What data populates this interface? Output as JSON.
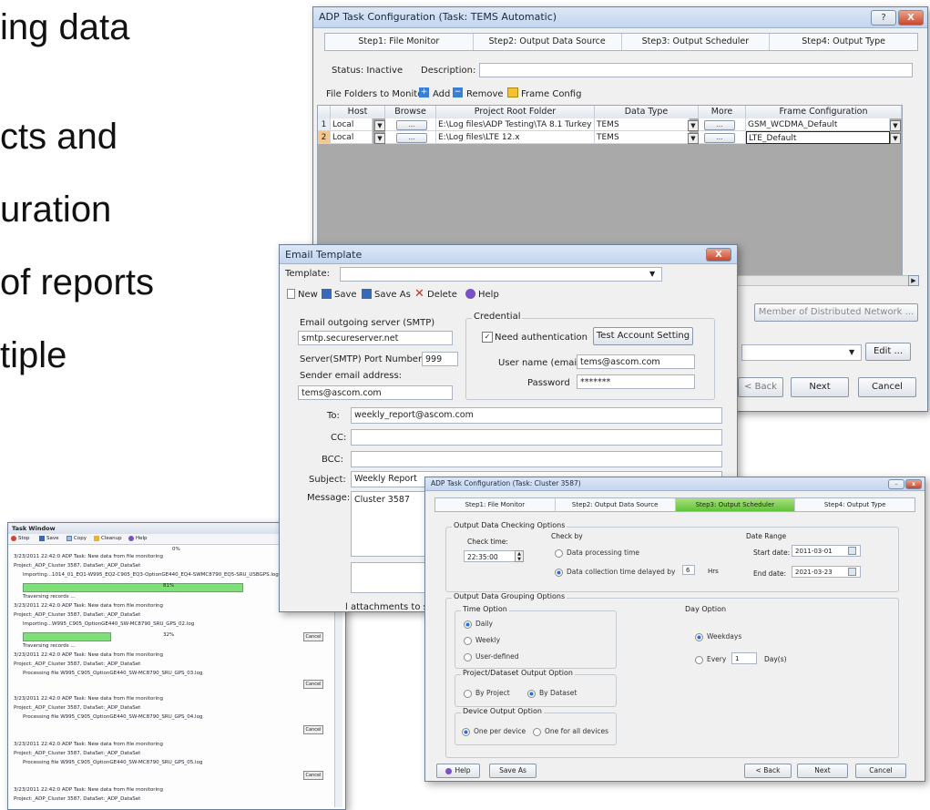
{
  "slide": {
    "bullets": [
      "ing data",
      "cts and",
      "uration",
      "of reports",
      "tiple"
    ]
  },
  "adp_main": {
    "title": "ADP Task Configuration    (Task: TEMS Automatic)",
    "help_btn": "?",
    "close_btn": "X",
    "steps": [
      "Step1: File Monitor",
      "Step2: Output Data Source",
      "Step3: Output Scheduler",
      "Step4: Output Type"
    ],
    "status_label": "Status: Inactive",
    "description_label": "Description:",
    "description_value": "",
    "folders_label": "File Folders to Monitor:",
    "add_label": "Add",
    "remove_label": "Remove",
    "frame_config_label": "Frame Config",
    "columns": [
      "Host",
      "Browse",
      "Project Root Folder",
      "Data Type",
      "More",
      "Frame Configuration"
    ],
    "rows": [
      {
        "num": "1",
        "host": "Local",
        "browse": "...",
        "folder": "E:\\Log files\\ADP Testing\\TA 8.1 Turkey",
        "data_type": "TEMS",
        "more": "...",
        "frame": "GSM_WCDMA_Default"
      },
      {
        "num": "2",
        "host": "Local",
        "browse": "...",
        "folder": "E:\\Log files\\LTE 12.x",
        "data_type": "TEMS",
        "more": "...",
        "frame": "LTE_Default"
      }
    ],
    "member_btn": "Member of Distributed Network ...",
    "edit_btn": "Edit ...",
    "back_btn": "< Back",
    "next_btn": "Next",
    "cancel_btn": "Cancel"
  },
  "email": {
    "title": "Email Template",
    "close_btn": "X",
    "template_label": "Template:",
    "toolbar": {
      "new": "New",
      "save": "Save",
      "save_as": "Save As",
      "delete": "Delete",
      "help": "Help"
    },
    "smtp_label": "Email outgoing server (SMTP)",
    "smtp_value": "smtp.secureserver.net",
    "port_label": "Server(SMTP) Port Number",
    "port_value": "999",
    "sender_label": "Sender email address:",
    "sender_value": "tems@ascom.com",
    "credential_label": "Credential",
    "need_auth_label": "Need authentication",
    "test_btn": "Test Account Setting",
    "username_label": "User name (email)",
    "username_value": "tems@ascom.com",
    "password_label": "Password",
    "password_value": "*******",
    "to_label": "To:",
    "to_value": "weekly_report@ascom.com",
    "cc_label": "CC:",
    "bcc_label": "BCC:",
    "subject_label": "Subject:",
    "subject_value": "Weekly Report",
    "message_label": "Message:",
    "message_value": "Cluster 3587",
    "attachments_text": "l attachments to sing"
  },
  "task_window": {
    "title": "Task Window",
    "pin": "#",
    "toolbar": {
      "stop": "Stop",
      "save": "Save",
      "copy": "Copy",
      "cleanup": "Cleanup",
      "help": "Help"
    },
    "lines": [
      "0%",
      "3/23/2011 22:42:0 ADP Task: New data from file monitoring",
      "Project:_ADP_Cluster 3587, DataSet:_ADP_DataSet",
      "Importing...1014_01_EQ1-W995_EQ2-C905_EQ3-OptionGE440_EQ4-SWMC8790_EQ5-SRU_USBGPS.log",
      "81%",
      "Traversing records ...",
      "3/23/2011 22:42:0 ADP Task: New data from file monitoring",
      "Project:_ADP_Cluster 3587, DataSet:_ADP_DataSet",
      "Importing...W995_C905_OptionGE440_SW-MC8790_SRU_GPS_02.log",
      "32%",
      "Traversing records ...",
      "3/23/2011 22:42:0 ADP Task: New data from file monitoring",
      "Project:_ADP_Cluster 3587, DataSet:_ADP_DataSet",
      "Processing file W995_C905_OptionGE440_SW-MC8790_SRU_GPS_03.log",
      "3/23/2011 22:42:0 ADP Task: New data from file monitoring",
      "Project:_ADP_Cluster 3587, DataSet:_ADP_DataSet",
      "Processing file W995_C905_OptionGE440_SW-MC8790_SRU_GPS_04.log",
      "3/23/2011 22:42:0 ADP Task: New data from file monitoring",
      "Project:_ADP_Cluster 3587, DataSet:_ADP_DataSet",
      "Processing file W995_C905_OptionGE440_SW-MC8790_SRU_GPS_05.log",
      "3/23/2011 22:42:0 ADP Task: New data from file monitoring",
      "Project:_ADP_Cluster 3587, DataSet:_ADP_DataSet"
    ],
    "progress1": 0.81,
    "progress2": 0.32,
    "cancel": "Cancel"
  },
  "scheduler": {
    "title": "ADP Task Configuration    (Task: Cluster 3587)",
    "steps": [
      "Step1: File Monitor",
      "Step2: Output Data Source",
      "Step3: Output Scheduler",
      "Step4: Output Type"
    ],
    "checking_group": "Output Data Checking Options",
    "check_time_label": "Check time:",
    "check_time_value": "22:35:00",
    "check_by_label": "Check by",
    "processing_time": "Data processing time",
    "collection_time": "Data collection time delayed by",
    "delay_value": "6",
    "hrs": "Hrs",
    "date_range_label": "Date Range",
    "start_label": "Start date:",
    "start_value": "2011-03-01",
    "end_label": "End date:",
    "end_value": "2021-03-23",
    "grouping_group": "Output Data Grouping Options",
    "time_option": "Time Option",
    "daily": "Daily",
    "weekly": "Weekly",
    "user_defined": "User-defined",
    "day_option": "Day Option",
    "weekdays": "Weekdays",
    "every": "Every",
    "every_value": "1",
    "days": "Day(s)",
    "project_dataset_option": "Project/Dataset Output Option",
    "by_project": "By Project",
    "by_dataset": "By Dataset",
    "device_option": "Device Output Option",
    "one_per_device": "One per device",
    "one_for_all": "One for all devices",
    "help_btn": "Help",
    "save_as_btn": "Save As",
    "back_btn": "< Back",
    "next_btn": "Next",
    "cancel_btn": "Cancel"
  },
  "colors": {
    "accent_green": "#62c23a",
    "title_blue": "#c3d5ee",
    "close_red": "#c8482a"
  }
}
